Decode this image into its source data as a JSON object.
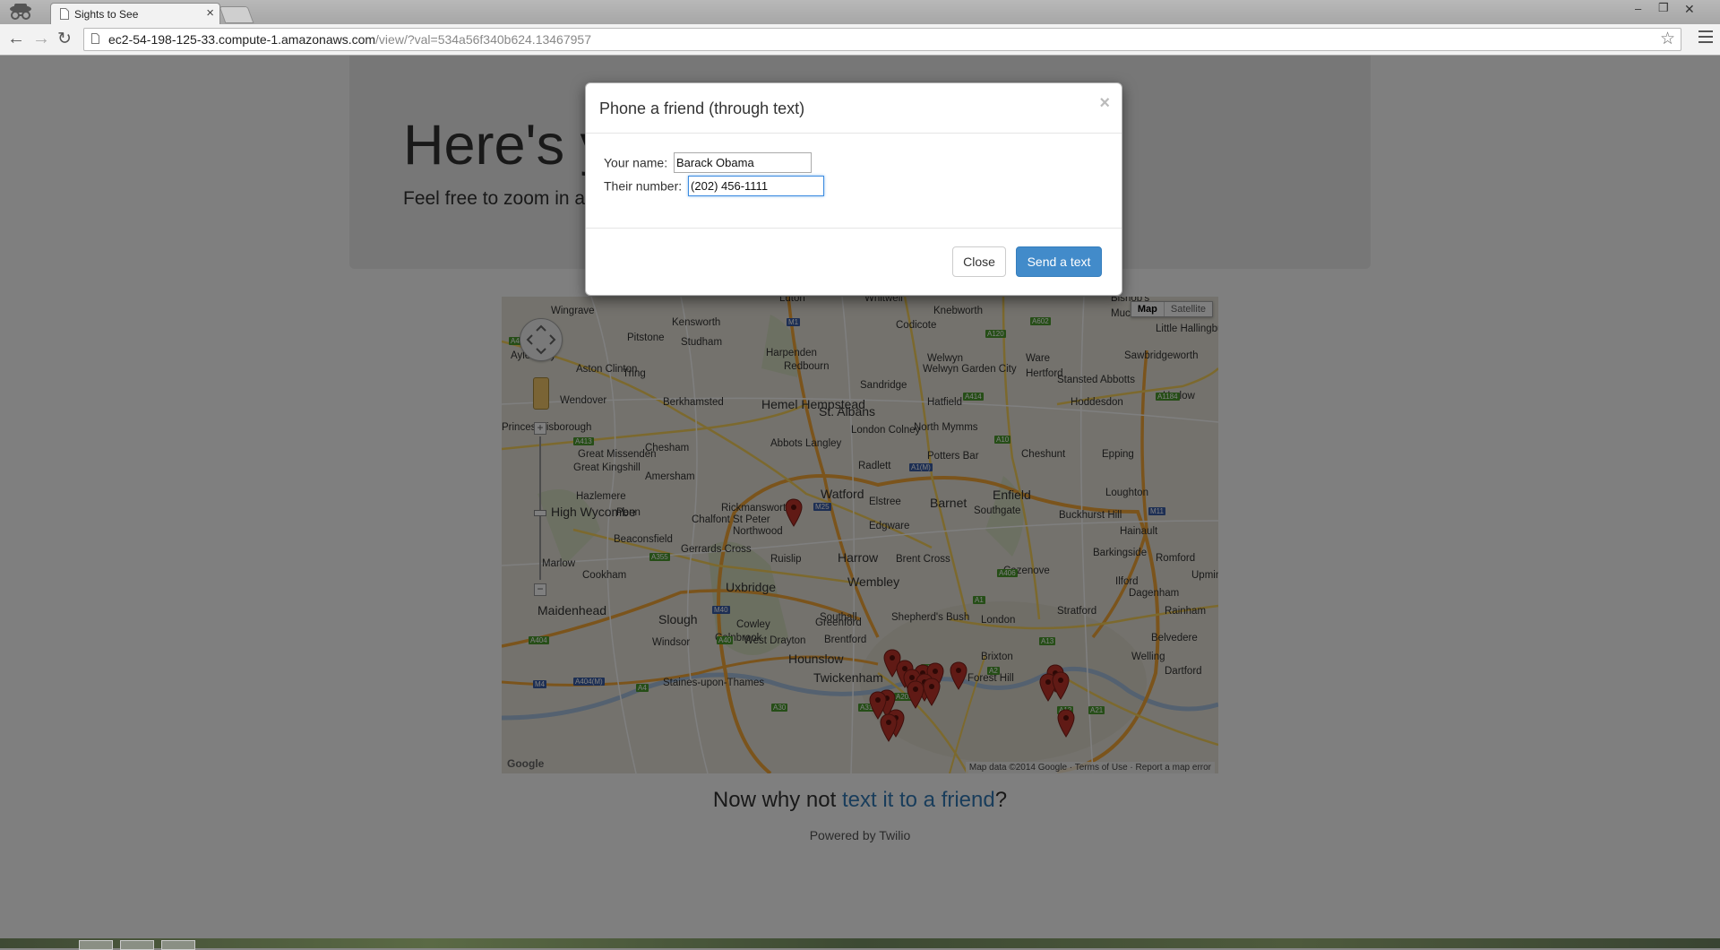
{
  "browser": {
    "tab_title": "Sights to See",
    "url_host": "ec2-54-198-125-33.compute-1.amazonaws.com",
    "url_path": "/view/?val=534a56f340b624.13467957"
  },
  "page": {
    "title": "Here's y",
    "lead": "Feel free to zoom in a",
    "footer_prefix": "Now why not ",
    "footer_link": "text it to a friend",
    "footer_suffix": "?",
    "powered_by": "Powered by Twilio"
  },
  "map": {
    "type_map": "Map",
    "type_satellite": "Satellite",
    "attribution": "Map data ©2014 Google  ·  Terms of Use  ·  Report a map error",
    "google_logo": "Google",
    "places": [
      "Wingrave",
      "Kensworth",
      "Luton",
      "Whitwell",
      "Knebworth",
      "Bishop's",
      "Much Hadham",
      "Little Hallingbury",
      "Sawbridgeworth",
      "Aylesbury",
      "Pitstone",
      "Studham",
      "Harpenden",
      "Codicote",
      "Welwyn",
      "Welwyn Garden City",
      "Ware",
      "Stansted Abbotts",
      "Aston Clinton",
      "Tring",
      "Redbourn",
      "Hertford",
      "Wendover",
      "Berkhamsted",
      "Hemel Hempstead",
      "St. Albans",
      "Sandridge",
      "Hatfield",
      "Hoddesdon",
      "Harlow",
      "Princes Risborough",
      "London Colney",
      "North Mymms",
      "Abbots Langley",
      "Great Missenden",
      "Chesham",
      "Potters Bar",
      "Cheshunt",
      "Epping",
      "Great Kingshill",
      "Amersham",
      "Radlett",
      "Hazlemere",
      "Watford",
      "Elstree",
      "Barnet",
      "Enfield",
      "Loughton",
      "High Wycombe",
      "Penn",
      "Rickmansworth",
      "Chalfont St Peter",
      "Southgate",
      "Buckhurst Hill",
      "Northwood",
      "Edgware",
      "Hainault",
      "Beaconsfield",
      "Gerrards Cross",
      "Ruislip",
      "Harrow",
      "Brent Cross",
      "Barkingside",
      "Romford",
      "Marlow",
      "Cookham",
      "Uxbridge",
      "Wembley",
      "Cazenove",
      "Ilford",
      "Upminster",
      "Maidenhead",
      "Cowley",
      "Greenford",
      "Stratford",
      "Dagenham",
      "Rainham",
      "Slough",
      "West Drayton",
      "Southall",
      "Shepherd's Bush",
      "London",
      "Belvedere",
      "Windsor",
      "Colnbrook",
      "Brentford",
      "Hounslow",
      "Brixton",
      "Welling",
      "Staines-upon-Thames",
      "Twickenham",
      "Forest Hill",
      "Dartford"
    ],
    "roads": [
      "M1",
      "M25",
      "M40",
      "M4",
      "M11",
      "A41",
      "A413",
      "A414",
      "A10",
      "A1",
      "A406",
      "A404",
      "A355",
      "A40",
      "A30",
      "A316",
      "A205",
      "A13",
      "A12",
      "A2",
      "A1(M)",
      "A602",
      "A120",
      "A1184",
      "A404(M)",
      "A4",
      "A3",
      "A21"
    ],
    "marker_count": 18
  },
  "modal": {
    "title": "Phone a friend (through text)",
    "close_icon": "×",
    "name_label": "Your name:",
    "name_value": "Barack Obama",
    "number_label": "Their number:",
    "number_value": "(202) 456-1111",
    "close_label": "Close",
    "send_label": "Send a text"
  },
  "window_controls": {
    "minimize": "–",
    "restore": "❐",
    "close": "✕"
  },
  "colors": {
    "primary": "#428bca",
    "link": "#337ab7",
    "marker": "#c0352b"
  }
}
